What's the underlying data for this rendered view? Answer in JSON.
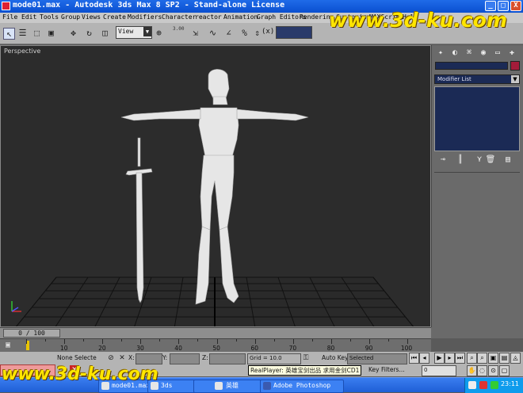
{
  "window": {
    "title": "mode01.max - Autodesk 3ds Max 8 SP2  - Stand-alone License",
    "controls": [
      "_",
      "□",
      "X"
    ]
  },
  "watermark": "www.3d-ku.com",
  "menu": [
    "File",
    "Edit",
    "Tools",
    "Group",
    "Views",
    "Create",
    "Modifiers",
    "Character",
    "reactor",
    "Animation",
    "Graph Editors",
    "Rendering",
    "Customize",
    "MAXScript",
    "Help"
  ],
  "toolbar": {
    "coord_system": "View",
    "spinner_text": "3.00",
    "angle_snap_text": "(x)"
  },
  "viewport": {
    "label": "Perspective",
    "background": "#2c2c2c",
    "model_color": "#e6e6e6"
  },
  "command_panel": {
    "modifier_list_label": "Modifier List",
    "tabs": [
      "create-icon",
      "modify-icon",
      "hierarchy-icon",
      "motion-icon",
      "display-icon",
      "utilities-icon"
    ],
    "object_color": "#a31b3a"
  },
  "time_slider": {
    "frame_text": "0 / 100"
  },
  "track_bar": {
    "ticks": [
      "10",
      "20",
      "30",
      "40",
      "50",
      "60",
      "70",
      "80",
      "90",
      "100"
    ]
  },
  "status": {
    "selection": "None Selecte",
    "x_label": "X:",
    "y_label": "Y:",
    "z_label": "Z:",
    "grid": "Grid = 10.0",
    "auto_key": "Auto Key",
    "selected_mode": "Selected",
    "set_key": "Set Key",
    "key_filters": "Key Filters...",
    "frame_field": "0"
  },
  "tooltip": "RealPlayer: 英雄宝剑出品 求用金剑CD1",
  "taskbar": {
    "items": [
      "mode01.max",
      "3ds",
      "英雄",
      "Adobe Photoshop"
    ],
    "clock": "23:11"
  }
}
